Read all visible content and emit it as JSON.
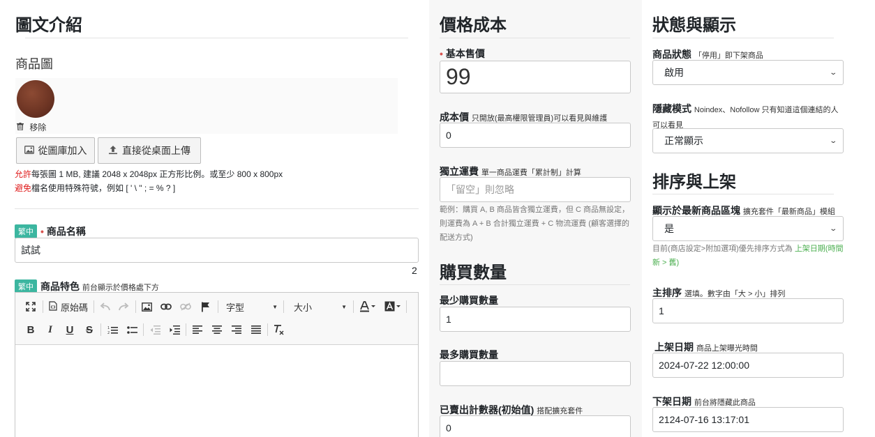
{
  "col1": {
    "heading": "圖文介紹",
    "image_section_title": "商品圖",
    "remove_label": "移除",
    "add_from_library_label": "從圖庫加入",
    "upload_from_desktop_label": "直接從桌面上傳",
    "allow_prefix": "允許",
    "allow_text": "每張圖 1 MB, 建議 2048 x 2048px 正方形比例。或至少 800 x 800px",
    "avoid_prefix": "避免",
    "avoid_text": "檔名使用特殊符號，例如 [ ' \\ \" ; = % ? ]",
    "name_badge": "繁中",
    "name_label": "商品名稱",
    "name_value": "試試",
    "name_count": "2",
    "feature_badge": "繁中",
    "feature_label": "商品特色",
    "feature_hint": "前台顯示於價格處下方",
    "editor": {
      "source_label": "原始碼",
      "font_label": "字型",
      "size_label": "大小"
    }
  },
  "col2": {
    "heading": "價格成本",
    "base_price_label": "基本售價",
    "base_price_value": "99",
    "cost_label": "成本價",
    "cost_hint": "只開放(最高權限管理員)可以看見與維護",
    "cost_value": "0",
    "shipping_label": "獨立運費",
    "shipping_hint": "單一商品運費「累計制」計算",
    "shipping_placeholder": "「留空」則忽略",
    "shipping_note": "範例：購買 A, B 商品皆含獨立運費，但 C 商品無設定，則運費為 A + B 合計獨立運費 + C 物流運費 (顧客選擇的配送方式)",
    "qty_heading": "購買數量",
    "min_qty_label": "最少購買數量",
    "min_qty_value": "1",
    "max_qty_label": "最多購買數量",
    "max_qty_value": "",
    "sold_counter_label": "已賣出計數器(初始值)",
    "sold_counter_hint": "搭配擴充套件",
    "sold_counter_value": "0"
  },
  "col3": {
    "heading": "狀態與顯示",
    "status_label": "商品狀態",
    "status_hint": "「停用」即下架商品",
    "status_value": "啟用",
    "hidden_label": "隱藏模式",
    "hidden_hint": "Noindex、Nofollow 只有知道這個連結的人可以看見",
    "hidden_value": "正常顯示",
    "sort_heading": "排序與上架",
    "newest_label": "顯示於最新商品區塊",
    "newest_hint": "擴充套件「最新商品」模組",
    "newest_value": "是",
    "newest_note_prefix": "目前(商店設定>附加選項)優先排序方式為",
    "newest_note_highlight": "上架日期(時間新 > 舊)",
    "main_sort_label": "主排序",
    "main_sort_hint": "選填。數字由「大 > 小」排列",
    "main_sort_value": "1",
    "publish_label": "上架日期",
    "publish_hint": "商品上架曝光時間",
    "publish_value": "2024-07-22 12:00:00",
    "unpublish_label": "下架日期",
    "unpublish_hint": "前台將隱藏此商品",
    "unpublish_value": "2124-07-16 13:17:01"
  },
  "colors": {
    "badge": "#3cb6a0",
    "required": "#d9534f",
    "highlight": "#4caf50",
    "mid_panel": "#f7f7f7"
  }
}
